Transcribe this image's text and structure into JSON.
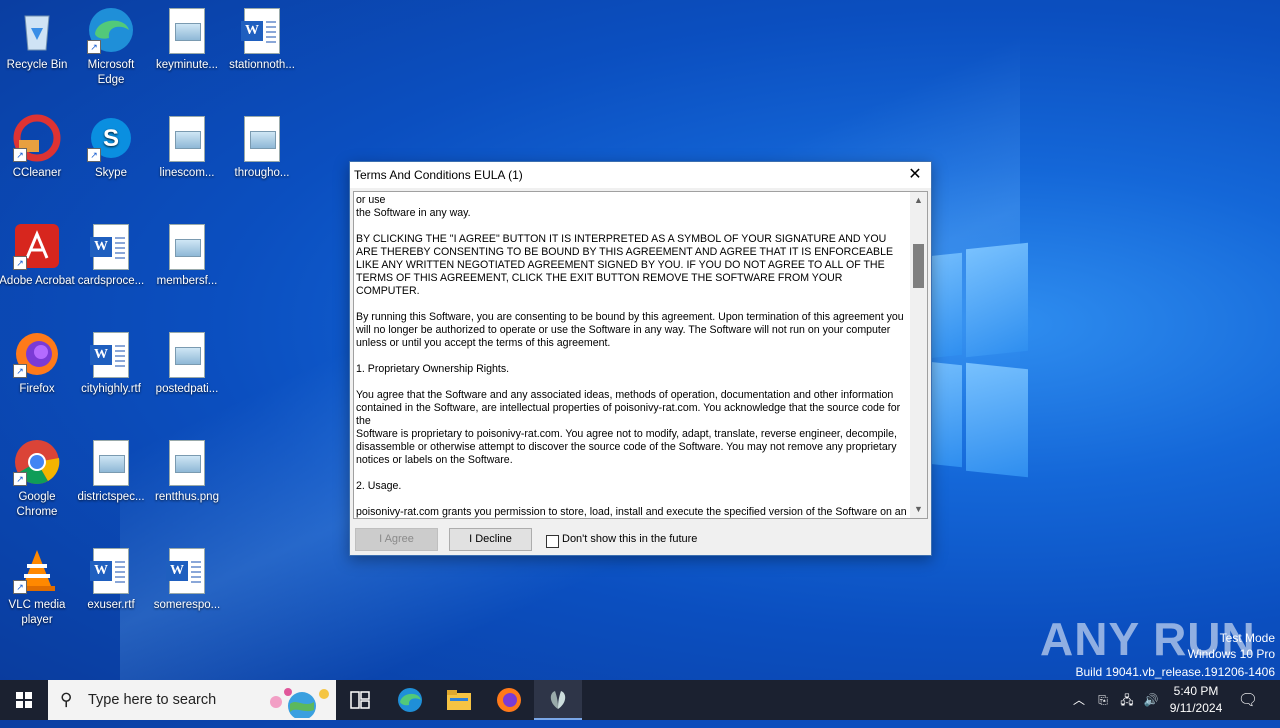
{
  "desktop": {
    "icons": [
      {
        "label": "Recycle Bin"
      },
      {
        "label": "Microsoft Edge"
      },
      {
        "label": "keyminute..."
      },
      {
        "label": "stationnoth..."
      },
      {
        "label": "CCleaner"
      },
      {
        "label": "Skype"
      },
      {
        "label": "linescom..."
      },
      {
        "label": "througho..."
      },
      {
        "label": "Adobe Acrobat"
      },
      {
        "label": "cardsproce..."
      },
      {
        "label": "membersf..."
      },
      {
        "label": "Firefox"
      },
      {
        "label": "cityhighly.rtf"
      },
      {
        "label": "postedpati..."
      },
      {
        "label": "Google Chrome"
      },
      {
        "label": "districtspec..."
      },
      {
        "label": "rentthus.png"
      },
      {
        "label": "VLC media player"
      },
      {
        "label": "exuser.rtf"
      },
      {
        "label": "somerespo..."
      }
    ]
  },
  "dialog": {
    "title": "Terms And Conditions EULA (1)",
    "text": "or use\nthe Software in any way.\n\nBY CLICKING THE \"I AGREE\" BUTTON IT IS INTERPRETED AS A SYMBOL OF YOUR SIGNATURE AND YOU ARE THEREBY CONSENTING TO BE BOUND BY THIS AGREEMENT AND AGREE THAT IT IS ENFORCEABLE LIKE ANY WRITTEN NEGOTIATED AGREEMENT SIGNED BY YOU. IF YOU DO NOT AGREE TO ALL OF THE TERMS OF THIS AGREEMENT, CLICK THE EXIT BUTTON REMOVE THE SOFTWARE FROM YOUR COMPUTER.\n\nBy running this Software, you are consenting to be bound by this agreement. Upon termination of this agreement you will no longer be authorized to operate or use the Software in any way. The Software will not run on your computer unless or until you accept the terms of this agreement.\n\n1. Proprietary Ownership Rights.\n\nYou agree that the Software and any associated ideas, methods of operation, documentation and other information contained in the Software, are intellectual properties of poisonivy-rat.com. You acknowledge that the source code for the\nSoftware is proprietary to poisonivy-rat.com. You agree not to modify, adapt, translate, reverse engineer, decompile, disassemble or otherwise attempt to discover the source code of the Software. You may not remove any proprietary notices or labels on the Software.\n\n2. Usage.\n\npoisonivy-rat.com grants you permission to store, load, install and execute the specified version of the Software on an",
    "agree_label": "I Agree",
    "decline_label": "I Decline",
    "checkbox_label": "Don't show this in the future",
    "close_glyph": "✕"
  },
  "watermark": {
    "text": "ANY RUN",
    "mode": "Test Mode",
    "edition": "Windows 10 Pro",
    "build": "Build 19041.vb_release.191206-1406"
  },
  "taskbar": {
    "search_placeholder": "Type here to search",
    "time": "5:40 PM",
    "date": "9/11/2024"
  }
}
